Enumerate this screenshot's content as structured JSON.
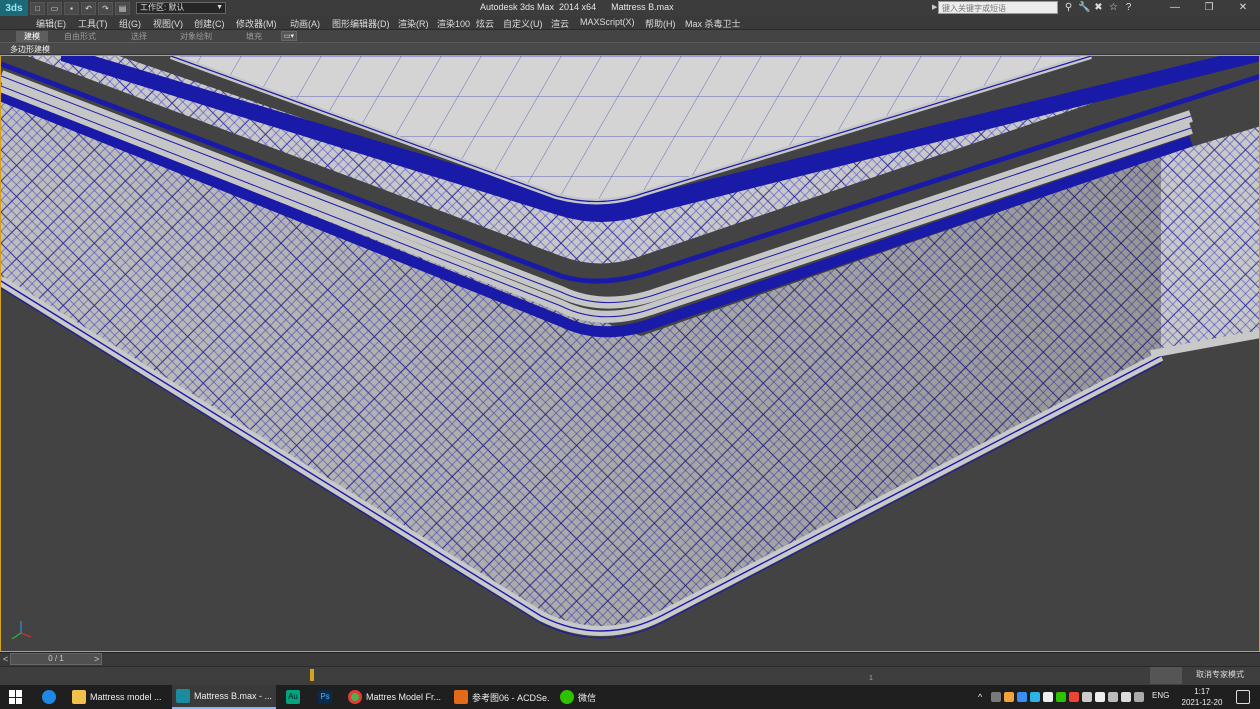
{
  "window": {
    "app_logo": "3ds",
    "title": "Autodesk 3ds Max  2014 x64      Mattress B.max",
    "workspace_value": "工作区: 默认",
    "search_placeholder": "键入关键字或短语",
    "controls": {
      "minimize": "—",
      "restore": "❐",
      "close": "✕"
    }
  },
  "quick_access": [
    "new-icon",
    "open-icon",
    "save-icon",
    "undo-icon",
    "redo-icon",
    "project-icon"
  ],
  "menu": [
    "编辑(E)",
    "工具(T)",
    "组(G)",
    "视图(V)",
    "创建(C)",
    "修改器(M)",
    "动画(A)",
    "图形编辑器(D)",
    "渲染(R)",
    "渲染100",
    "炫云",
    "自定义(U)",
    "渲云",
    "MAXScript(X)",
    "帮助(H)",
    "Max 杀毒卫士"
  ],
  "ribbon": {
    "tabs": [
      "建模",
      "自由形式",
      "选择",
      "对象绘制",
      "填充"
    ],
    "active_tab": "建模",
    "panel_label": "多边形建模"
  },
  "timeline": {
    "frame": "0 / 1",
    "prev": "<",
    "next": ">",
    "mid_mark": "1",
    "expert_mode": "取消专家模式"
  },
  "taskbar": {
    "apps": [
      {
        "label": "Mattress model ...",
        "icon": "folder-icon",
        "color": "#f2c14b"
      },
      {
        "label": "Mattress B.max - ...",
        "icon": "3dsmax-icon",
        "color": "#1b8ba0",
        "active": true
      },
      {
        "label": "",
        "icon": "audition-icon",
        "color": "#00a67e",
        "text": "Au"
      },
      {
        "label": "",
        "icon": "photoshop-icon",
        "color": "#0b2a4a",
        "text": "Ps"
      },
      {
        "label": "Mattres Model Fr...",
        "icon": "chrome-icon",
        "color": "#4caf50"
      },
      {
        "label": "参考图06 - ACDSe...",
        "icon": "acdsee-icon",
        "color": "#e46a1a"
      },
      {
        "label": "微信",
        "icon": "wechat-icon",
        "color": "#2dc100"
      }
    ],
    "language": "ENG",
    "time": "1:17",
    "date": "2021-12-20"
  },
  "colors": {
    "wire": "#1a1aa8",
    "surface": "#bdbdbd",
    "viewport_bg": "#434343",
    "viewport_border": "#d4a21b"
  }
}
